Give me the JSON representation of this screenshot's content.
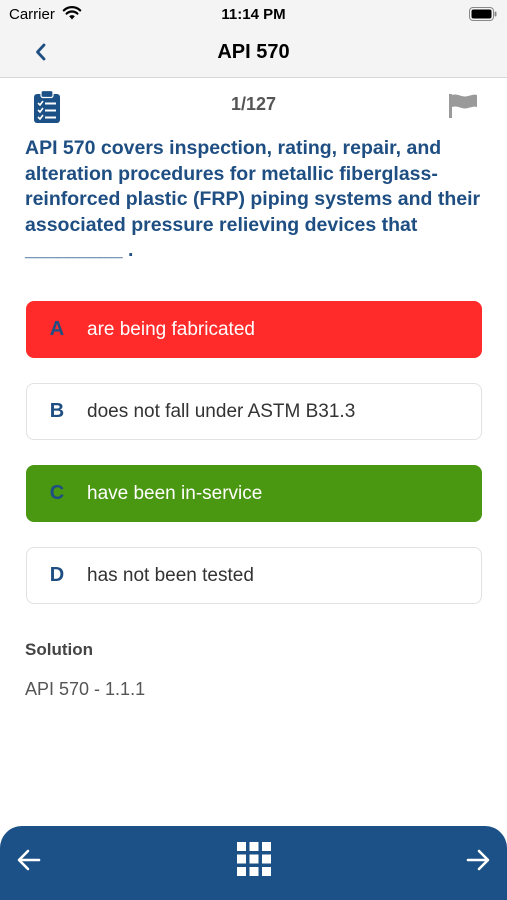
{
  "status_bar": {
    "carrier": "Carrier",
    "time": "11:14 PM",
    "icons": [
      "wifi-icon",
      "battery-icon"
    ]
  },
  "nav": {
    "title": "API 570",
    "back_icon": "chevron-left-icon"
  },
  "quiz": {
    "counter": "1/127",
    "question": "API 570 covers inspection, rating, repair, and alteration procedures for metallic fiberglass-reinforced plastic (FRP) piping systems and their associated pressure relieving devices that _________ .",
    "options": [
      {
        "letter": "A",
        "text": "are being fabricated",
        "state": "wrong"
      },
      {
        "letter": "B",
        "text": "does not fall under ASTM B31.3",
        "state": "neutral"
      },
      {
        "letter": "C",
        "text": "have been in-service",
        "state": "correct"
      },
      {
        "letter": "D",
        "text": "has not been tested",
        "state": "neutral"
      }
    ],
    "icons": [
      "clipboard-checklist-icon",
      "flag-icon"
    ]
  },
  "solution": {
    "label": "Solution",
    "text": "API 570 - 1.1.1"
  },
  "bottom_bar": {
    "icons": [
      "arrow-left-icon",
      "grid-icon",
      "arrow-right-icon"
    ]
  },
  "colors": {
    "primary": "#1e4e82",
    "bottom_bar": "#1b5186",
    "wrong": "#ff2a2a",
    "correct": "#4a9712"
  }
}
